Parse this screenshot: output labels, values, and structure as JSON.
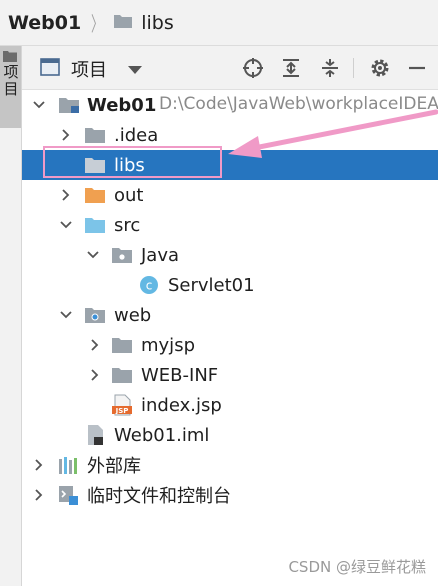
{
  "breadcrumb": {
    "root": "Web01",
    "item": "libs"
  },
  "stripe": {
    "label": "项目"
  },
  "toolbar": {
    "title": "项目",
    "buttons": [
      "locate-icon",
      "expand-all-icon",
      "collapse-all-icon",
      "gear-icon",
      "minimize-icon"
    ]
  },
  "tree": {
    "root": {
      "name": "Web01",
      "path": "D:\\Code\\JavaWeb\\workplaceIDEA"
    },
    "items": [
      {
        "name": ".idea"
      },
      {
        "name": "libs"
      },
      {
        "name": "out"
      },
      {
        "name": "src"
      },
      {
        "name": "Java"
      },
      {
        "name": "Servlet01"
      },
      {
        "name": "web"
      },
      {
        "name": "myjsp"
      },
      {
        "name": "WEB-INF"
      },
      {
        "name": "index.jsp"
      },
      {
        "name": "Web01.iml"
      },
      {
        "name": "外部库"
      },
      {
        "name": "临时文件和控制台"
      }
    ]
  },
  "colors": {
    "selection": "#2675bf",
    "annotation": "#f09ac7",
    "exclude_orange": "#f0a050",
    "source_blue": "#7cc4e8"
  },
  "watermark": "CSDN @绿豆鲜花糕"
}
